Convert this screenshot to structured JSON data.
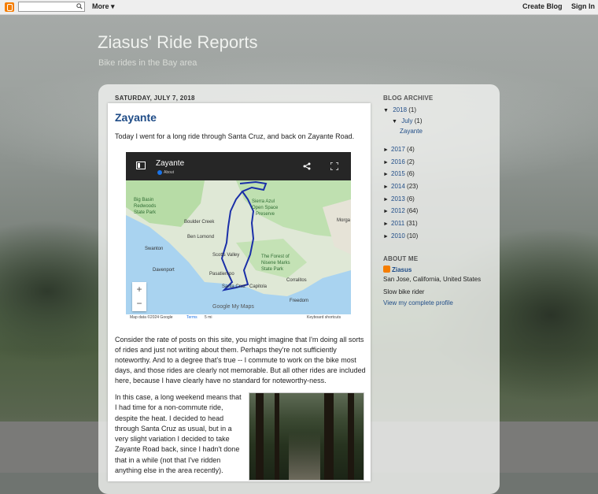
{
  "navbar": {
    "more": "More",
    "create_blog": "Create Blog",
    "sign_in": "Sign In"
  },
  "header": {
    "title": "Ziasus' Ride Reports",
    "description": "Bike rides in the Bay area"
  },
  "post": {
    "date": "SATURDAY, JULY 7, 2018",
    "title": "Zayante",
    "intro": "Today I went for a long ride through Santa Cruz, and back on Zayante Road.",
    "map": {
      "title": "Zayante",
      "about": "About",
      "labels": [
        "Big Basin",
        "Redwoods",
        "State Park",
        "Sierra Azul",
        "Open Space",
        "Preserve",
        "Boulder Creek",
        "Ben Lomond",
        "Scotts Valley",
        "Swanton",
        "Davenport",
        "The Forest of",
        "Nisene Marks",
        "State Park",
        "Pasatiempo",
        "Santa Cruz",
        "Capitola",
        "Corralitos",
        "Freedom",
        "Morga"
      ],
      "footer_data": "Map data ©2024 Google",
      "footer_terms": "Terms",
      "footer_scale": "5 mi",
      "footer_shortcuts": "Keyboard shortcuts",
      "brand": "Google My Maps",
      "zoom_in": "+",
      "zoom_out": "−"
    },
    "para1": "Consider the rate of posts on this site, you might imagine that I'm doing all sorts of rides and just not writing about them. Perhaps they're not sufficiently noteworthy. And to a degree that's true -- I commute to work on the bike most days, and those rides are clearly not memorable. But all other rides are included here, because I have clearly have no standard for noteworthy-ness.",
    "para2": "In this case, a long weekend means that I had time for a non-commute ride, despite the heat. I decided to head through Santa Cruz as usual, but in a very slight variation I decided to take Zayante Road back, since I hadn't done that in a while (not that I've ridden anything else in the area recently)."
  },
  "sidebar": {
    "archive_heading": "BLOG ARCHIVE",
    "years": [
      {
        "label": "2018",
        "count": "(1)",
        "expanded": true
      },
      {
        "label": "2017",
        "count": "(4)"
      },
      {
        "label": "2016",
        "count": "(2)"
      },
      {
        "label": "2015",
        "count": "(6)"
      },
      {
        "label": "2014",
        "count": "(23)"
      },
      {
        "label": "2013",
        "count": "(6)"
      },
      {
        "label": "2012",
        "count": "(64)"
      },
      {
        "label": "2011",
        "count": "(31)"
      },
      {
        "label": "2010",
        "count": "(10)"
      }
    ],
    "month": {
      "label": "July",
      "count": "(1)"
    },
    "post_link": "Zayante",
    "about_heading": "ABOUT ME",
    "about_name": "Ziasus",
    "location": "San Jose, California, United States",
    "bio": "Slow bike rider",
    "profile_link": "View my complete profile"
  },
  "colors": {
    "link": "#1f4c87",
    "blogger_orange": "#f57d00",
    "route": "#1a2fa8"
  }
}
